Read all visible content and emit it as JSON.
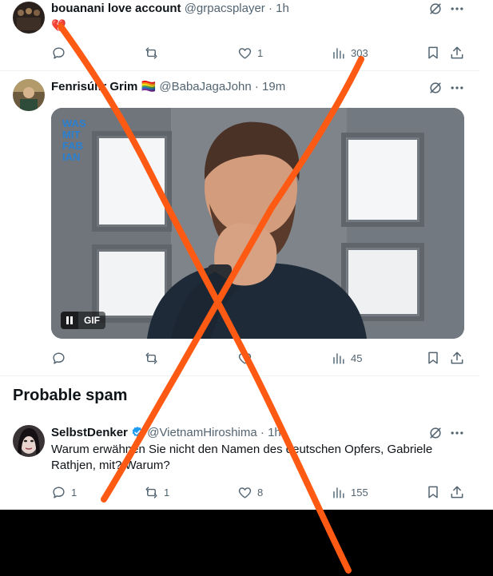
{
  "tweets": [
    {
      "display_name": "bouanani love account",
      "handle": "@grpacsplayer",
      "separator": "·",
      "time": "1h",
      "emoji": "💔",
      "replies": "",
      "retweets": "",
      "likes": "1",
      "views": "303"
    },
    {
      "display_name": "Fenrisúlfr Grim 🏳️‍🌈",
      "handle": "@BabaJagaJohn",
      "separator": "·",
      "time": "19m",
      "media": {
        "type": "GIF",
        "logo_lines": [
          "WAS",
          "MIT",
          "FAB",
          "IAN"
        ],
        "badge_label": "GIF"
      },
      "replies": "",
      "retweets": "",
      "likes": "",
      "views": "45"
    },
    {
      "display_name": "SelbstDenker",
      "handle": "@VietnamHiroshima",
      "separator": "·",
      "time": "1h",
      "verified": true,
      "text_line1": "Warum erwähnen Sie nicht den Namen des deutschen Opfers, Gabriele",
      "text_line2": "Rathjen, mit? Warum?",
      "replies": "1",
      "retweets": "1",
      "likes": "8",
      "views": "155"
    }
  ],
  "section_heading": "Probable spam",
  "colors": {
    "text": "#0f1419",
    "muted": "#536471",
    "verified": "#1d9bf0",
    "overlay_cross": "#ff5a14",
    "divider": "#eff3f4"
  },
  "icons": [
    "grok-icon",
    "more-icon",
    "reply-icon",
    "retweet-icon",
    "like-icon",
    "views-icon",
    "bookmark-icon",
    "share-icon",
    "pause-icon",
    "verified-badge-icon"
  ]
}
